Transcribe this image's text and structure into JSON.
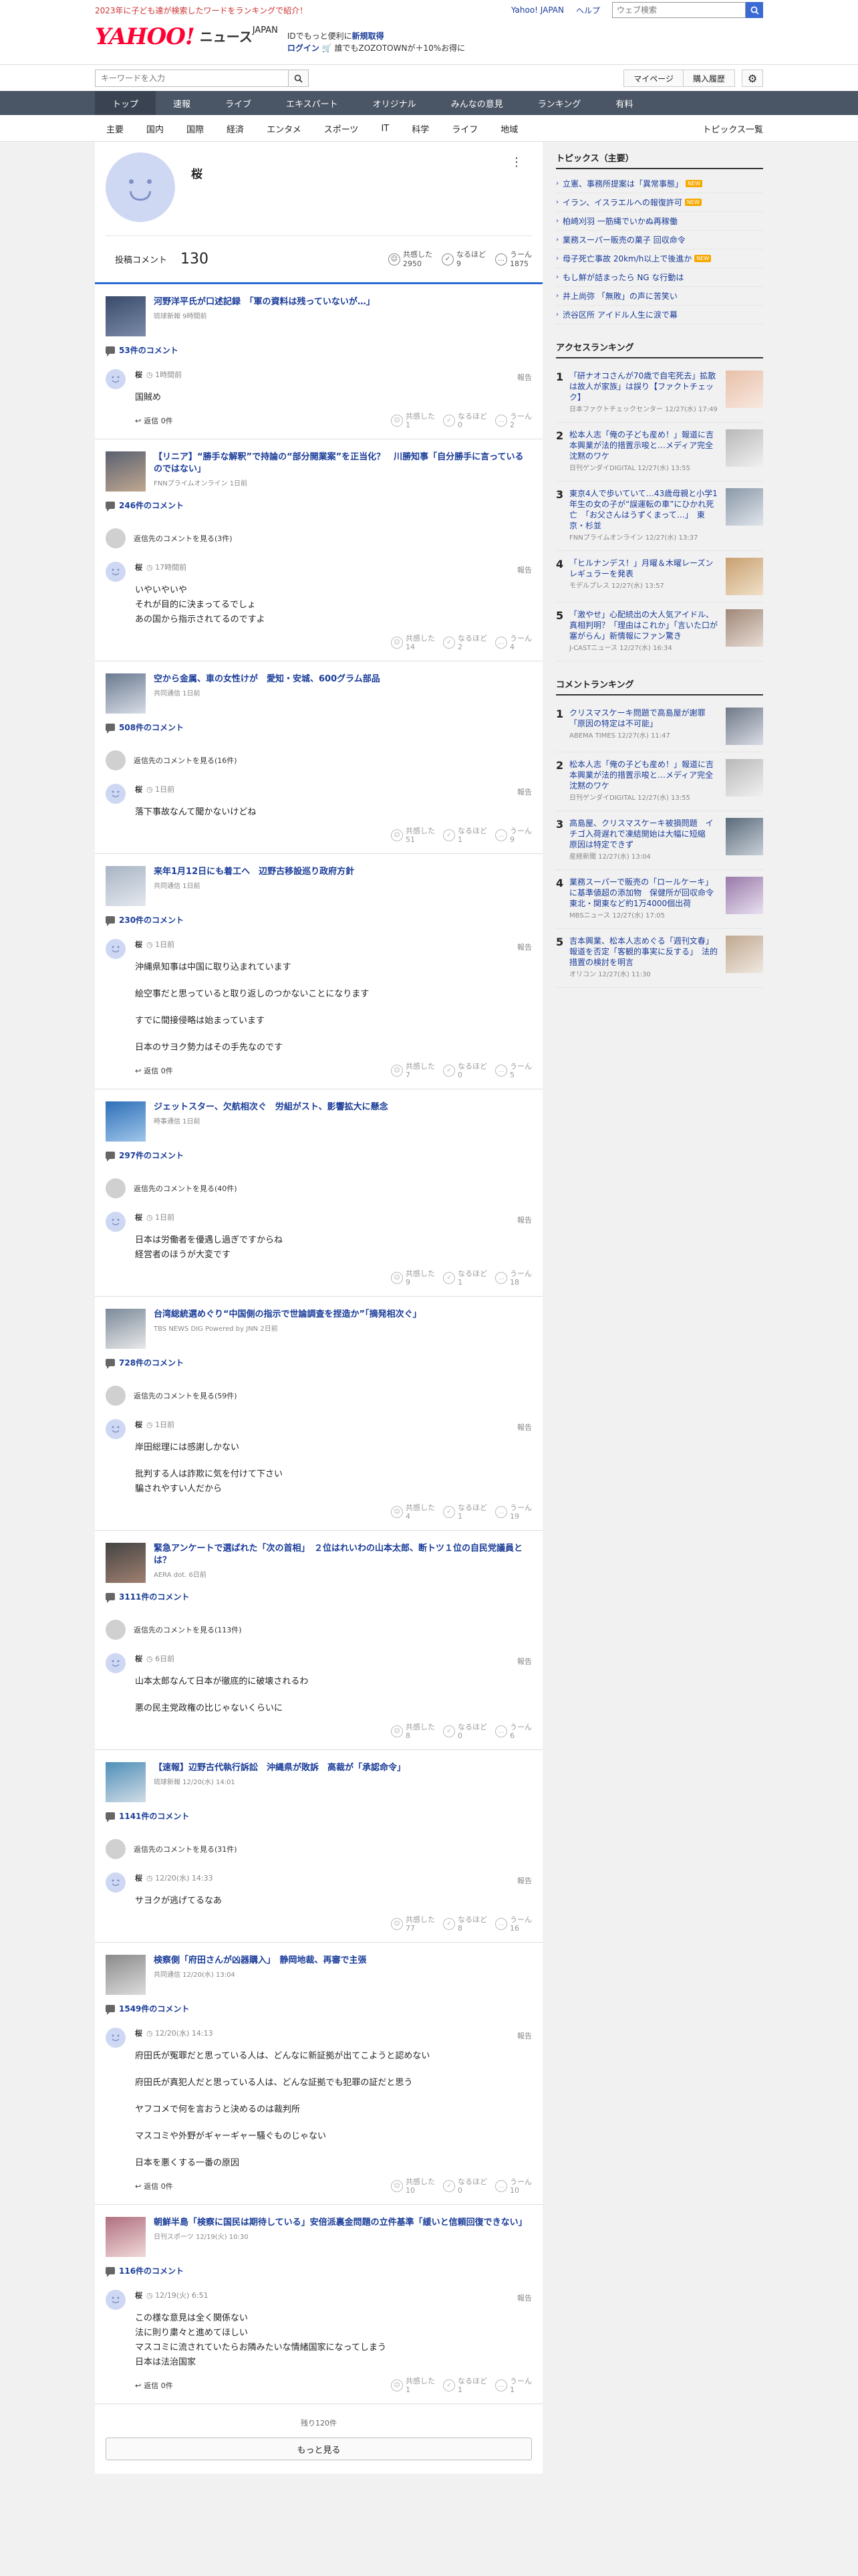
{
  "top": {
    "promo": "2023年に子ども達が検索したワードをランキングで紹介！",
    "yahoo_japan": "Yahoo! JAPAN",
    "help": "ヘルプ",
    "web_search_placeholder": "ウェブ検索"
  },
  "header": {
    "logo_main": "YAHOO!",
    "logo_sub": "JAPAN",
    "logo_news": "ニュース",
    "promo_line1_pre": "IDでもっと便利に",
    "promo_line1_link": "新規取得",
    "promo_line2_link": "ログイン",
    "promo_line2_text": "誰でもZOZOTOWNが＋10%お得に"
  },
  "search": {
    "placeholder": "キーワードを入力",
    "mypage": "マイページ",
    "purchase": "購入履歴"
  },
  "catnav": [
    "トップ",
    "速報",
    "ライブ",
    "エキスパート",
    "オリジナル",
    "みんなの意見",
    "ランキング",
    "有料"
  ],
  "subnav": [
    "主要",
    "国内",
    "国際",
    "経済",
    "エンタメ",
    "スポーツ",
    "IT",
    "科学",
    "ライフ",
    "地域"
  ],
  "subnav_list": "トピックス一覧",
  "profile": {
    "name": "桜",
    "comments_label": "投稿コメント",
    "comments_count": "130",
    "reactions": [
      {
        "label": "共感した",
        "count": "2950"
      },
      {
        "label": "なるほど",
        "count": "9"
      },
      {
        "label": "うーん",
        "count": "1875"
      }
    ]
  },
  "labels": {
    "report": "報告",
    "agree": "共感した",
    "hmm": "なるほど",
    "umm": "うーん"
  },
  "blocks": [
    {
      "title": "河野洋平氏が口述記録　「軍の資料は残っていないが…」",
      "source": "琉球新報 9時間前",
      "count": "53件のコメント",
      "prev": "",
      "user": "桜",
      "time": "1時間前",
      "lines": [
        "国賊め"
      ],
      "reply": "返信 0件",
      "r": [
        "1",
        "0",
        "2"
      ]
    },
    {
      "title": "【リニア】“勝手な解釈”で持論の“部分開業案”を正当化？　川勝知事「自分勝手に言っているのではない」",
      "source": "FNNプライムオンライン 1日前",
      "count": "246件のコメント",
      "prev": "返信先のコメントを見る(3件)",
      "user": "桜",
      "time": "17時間前",
      "lines": [
        "いやいやいや",
        "それが目的に決まってるでしょ",
        "あの国から指示されてるのですよ"
      ],
      "reply": "",
      "r": [
        "14",
        "2",
        "4"
      ]
    },
    {
      "title": "空から金属、車の女性けが　愛知・安城、600グラム部品",
      "source": "共同通信 1日前",
      "count": "508件のコメント",
      "prev": "返信先のコメントを見る(16件)",
      "user": "桜",
      "time": "1日前",
      "lines": [
        "落下事故なんて聞かないけどね"
      ],
      "reply": "",
      "r": [
        "51",
        "1",
        "9"
      ]
    },
    {
      "title": "来年1月12日にも着工へ　辺野古移設巡り政府方針",
      "source": "共同通信 1日前",
      "count": "230件のコメント",
      "prev": "",
      "user": "桜",
      "time": "1日前",
      "lines": [
        "沖縄県知事は中国に取り込まれています",
        "|",
        "絵空事だと思っていると取り返しのつかないことになります",
        "|",
        "すでに間接侵略は始まっています",
        "|",
        "日本のサヨク勢力はその手先なのです"
      ],
      "reply": "返信 0件",
      "r": [
        "7",
        "0",
        "5"
      ]
    },
    {
      "title": "ジェットスター、欠航相次ぐ　労組がスト、影響拡大に懸念",
      "source": "時事通信 1日前",
      "count": "297件のコメント",
      "prev": "返信先のコメントを見る(40件)",
      "user": "桜",
      "time": "1日前",
      "lines": [
        "日本は労働者を優遇し過ぎですからね",
        "経営者のほうが大変です"
      ],
      "reply": "",
      "r": [
        "9",
        "1",
        "18"
      ]
    },
    {
      "title": "台湾総統選めぐり“中国側の指示で世論調査を捏造か”「摘発相次ぐ」",
      "source": "TBS NEWS DIG Powered by JNN 2日前",
      "count": "728件のコメント",
      "prev": "返信先のコメントを見る(59件)",
      "user": "桜",
      "time": "1日前",
      "lines": [
        "岸田総理には感謝しかない",
        "|",
        "批判する人は詐欺に気を付けて下さい",
        "騙されやすい人だから"
      ],
      "reply": "",
      "r": [
        "4",
        "1",
        "19"
      ]
    },
    {
      "title": "緊急アンケートで選ばれた「次の首相」　２位はれいわの山本太郎、断トツ１位の自民党議員とは？",
      "source": "AERA dot. 6日前",
      "count": "3111件のコメント",
      "prev": "返信先のコメントを見る(113件)",
      "user": "桜",
      "time": "6日前",
      "lines": [
        "山本太郎なんて日本が徹底的に破壊されるわ",
        "|",
        "悪の民主党政権の比じゃないくらいに"
      ],
      "reply": "",
      "r": [
        "8",
        "0",
        "6"
      ]
    },
    {
      "title": "【速報】辺野古代執行訴訟　沖縄県が敗訴　高裁が「承認命令」",
      "source": "琉球新報 12/20(水) 14:01",
      "count": "1141件のコメント",
      "prev": "返信先のコメントを見る(31件)",
      "user": "桜",
      "time": "12/20(水) 14:33",
      "lines": [
        "サヨクが逃げてるなあ"
      ],
      "reply": "",
      "r": [
        "77",
        "8",
        "16"
      ]
    },
    {
      "title": "検察側「府田さんが凶器購入」　静岡地裁、再審で主張",
      "source": "共同通信 12/20(水) 13:04",
      "count": "1549件のコメント",
      "prev": "",
      "user": "桜",
      "time": "12/20(水) 14:13",
      "lines": [
        "府田氏が冤罪だと思っている人は、どんなに新証拠が出てこようと認めない",
        "|",
        "府田氏が真犯人だと思っている人は、どんな証拠でも犯罪の証だと思う",
        "|",
        "ヤフコメで何を言おうと決めるのは裁判所",
        "|",
        "マスコミや外野がギャーギャー騒ぐものじゃない",
        "|",
        "日本を悪くする一番の原因"
      ],
      "reply": "返信 0件",
      "r": [
        "10",
        "0",
        "10"
      ]
    },
    {
      "title": "朝鮮半島「検察に国民は期待している」安倍派裏金問題の立件基準「緩いと信頼回復できない」",
      "source": "日刊スポーツ 12/19(火) 10:30",
      "count": "116件のコメント",
      "prev": "",
      "user": "桜",
      "time": "12/19(火) 6:51",
      "lines": [
        "この様な意見は全く関係ない",
        "法に則り粛々と進めてほしい",
        "マスコミに流されていたらお隣みたいな情緒国家になってしまう",
        "日本は法治国家"
      ],
      "reply": "返信 0件",
      "r": [
        "1",
        "1",
        "1"
      ]
    }
  ],
  "more": {
    "remaining": "残り120件",
    "button": "もっと見る"
  },
  "sidebar": {
    "topics_title": "トピックス（主要）",
    "topics": [
      {
        "text": "立憲、事務所提案は「異常事態」",
        "badge": "NEW"
      },
      {
        "text": "イラン、イスラエルへの報復許可",
        "badge": "NEW"
      },
      {
        "text": "柏崎刈羽 一筋縄でいかぬ再稼働",
        "badge": ""
      },
      {
        "text": "業務スーパー販売の菓子 回収命令",
        "badge": ""
      },
      {
        "text": "母子死亡事故 20km/h以上で後進か",
        "badge": "NEW"
      },
      {
        "text": "もし鮮が詰まったら NG な行動は",
        "badge": ""
      },
      {
        "text": "井上尚弥 「無敗」の声に苦笑い",
        "badge": ""
      },
      {
        "text": "渋谷区所 アイドル人生に涙で幕",
        "badge": ""
      }
    ],
    "access_title": "アクセスランキング",
    "access": [
      {
        "no": "1",
        "text": "「研ナオコさんが70歳で自宅死去」拡散は故人が家族」は誤り【ファクトチェック】",
        "src": "日本ファクトチェックセンター 12/27(水) 17:49"
      },
      {
        "no": "2",
        "text": "松本人志「俺の子ども産め！」報道に吉本興業が法的措置示唆と…メディア完全沈黙のワケ",
        "src": "日刊ゲンダイDIGITAL 12/27(水) 13:55"
      },
      {
        "no": "3",
        "text": "東京4人で歩いていて…43歳母親と小学1年生の女の子が“誤運転の車”にひかれ死亡　「お父さんはうずくまって…」　東京・杉並",
        "src": "FNNプライムオンライン 12/27(水) 13:37"
      },
      {
        "no": "4",
        "text": "「ヒルナンデス！」月曜＆木曜レーズンレギュラーを発表",
        "src": "モデルプレス 12/27(水) 13:57"
      },
      {
        "no": "5",
        "text": "「激やせ」心配続出の大人気アイドル、真相判明？「理由はこれか」「言いた口が塞がらん」新情報にファン驚き",
        "src": "J-CASTニュース 12/27(水) 16:34"
      }
    ],
    "comment_title": "コメントランキング",
    "comment_rank": [
      {
        "no": "1",
        "text": "クリスマスケーキ問題で高島屋が謝罪「原因の特定は不可能」",
        "src": "ABEMA TIMES 12/27(水) 11:47"
      },
      {
        "no": "2",
        "text": "松本人志「俺の子ども産め！」報道に吉本興業が法的措置示唆と…メディア完全沈黙のワケ",
        "src": "日刊ゲンダイDIGITAL 12/27(水) 13:55"
      },
      {
        "no": "3",
        "text": "高島屋、クリスマスケーキ被損問題　イチゴ入荷遅れで凍結開始は大幅に短縮　原因は特定できず",
        "src": "産経新聞 12/27(水) 13:04"
      },
      {
        "no": "4",
        "text": "業務スーパーで販売の「ロールケーキ」に基準値超の添加物　保健所が回収命令　東北・関東など約1万4000個出荷",
        "src": "MBSニュース 12/27(水) 17:05"
      },
      {
        "no": "5",
        "text": "吉本興業、松本人志めぐる「週刊文春」報道を否定「客観的事実に反する」　法的措置の検討を明言",
        "src": "オリコン 12/27(水) 11:30"
      }
    ]
  },
  "colors": {
    "accent": "#2d6bd4",
    "link": "#1a3c99",
    "brand": "#ff0033",
    "nav": "#4a5566"
  }
}
